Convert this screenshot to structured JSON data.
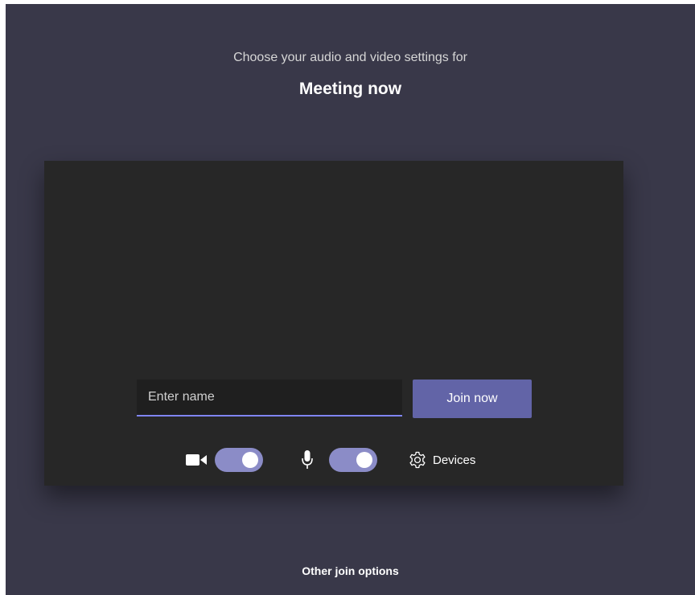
{
  "header": {
    "subtitle": "Choose your audio and video settings for",
    "title": "Meeting now"
  },
  "preview": {
    "name_input": {
      "placeholder": "Enter name",
      "value": ""
    },
    "join_label": "Join now",
    "controls": {
      "camera_icon": "video-camera-icon",
      "camera_on": true,
      "microphone_icon": "microphone-icon",
      "microphone_on": true,
      "devices_icon": "gear-icon",
      "devices_label": "Devices"
    }
  },
  "footer": {
    "other_options_label": "Other join options"
  },
  "colors": {
    "background": "#393849",
    "preview_bg": "#272727",
    "accent": "#6264a7",
    "toggle_on": "#8b8cc7",
    "input_underline": "#7f85f5"
  }
}
